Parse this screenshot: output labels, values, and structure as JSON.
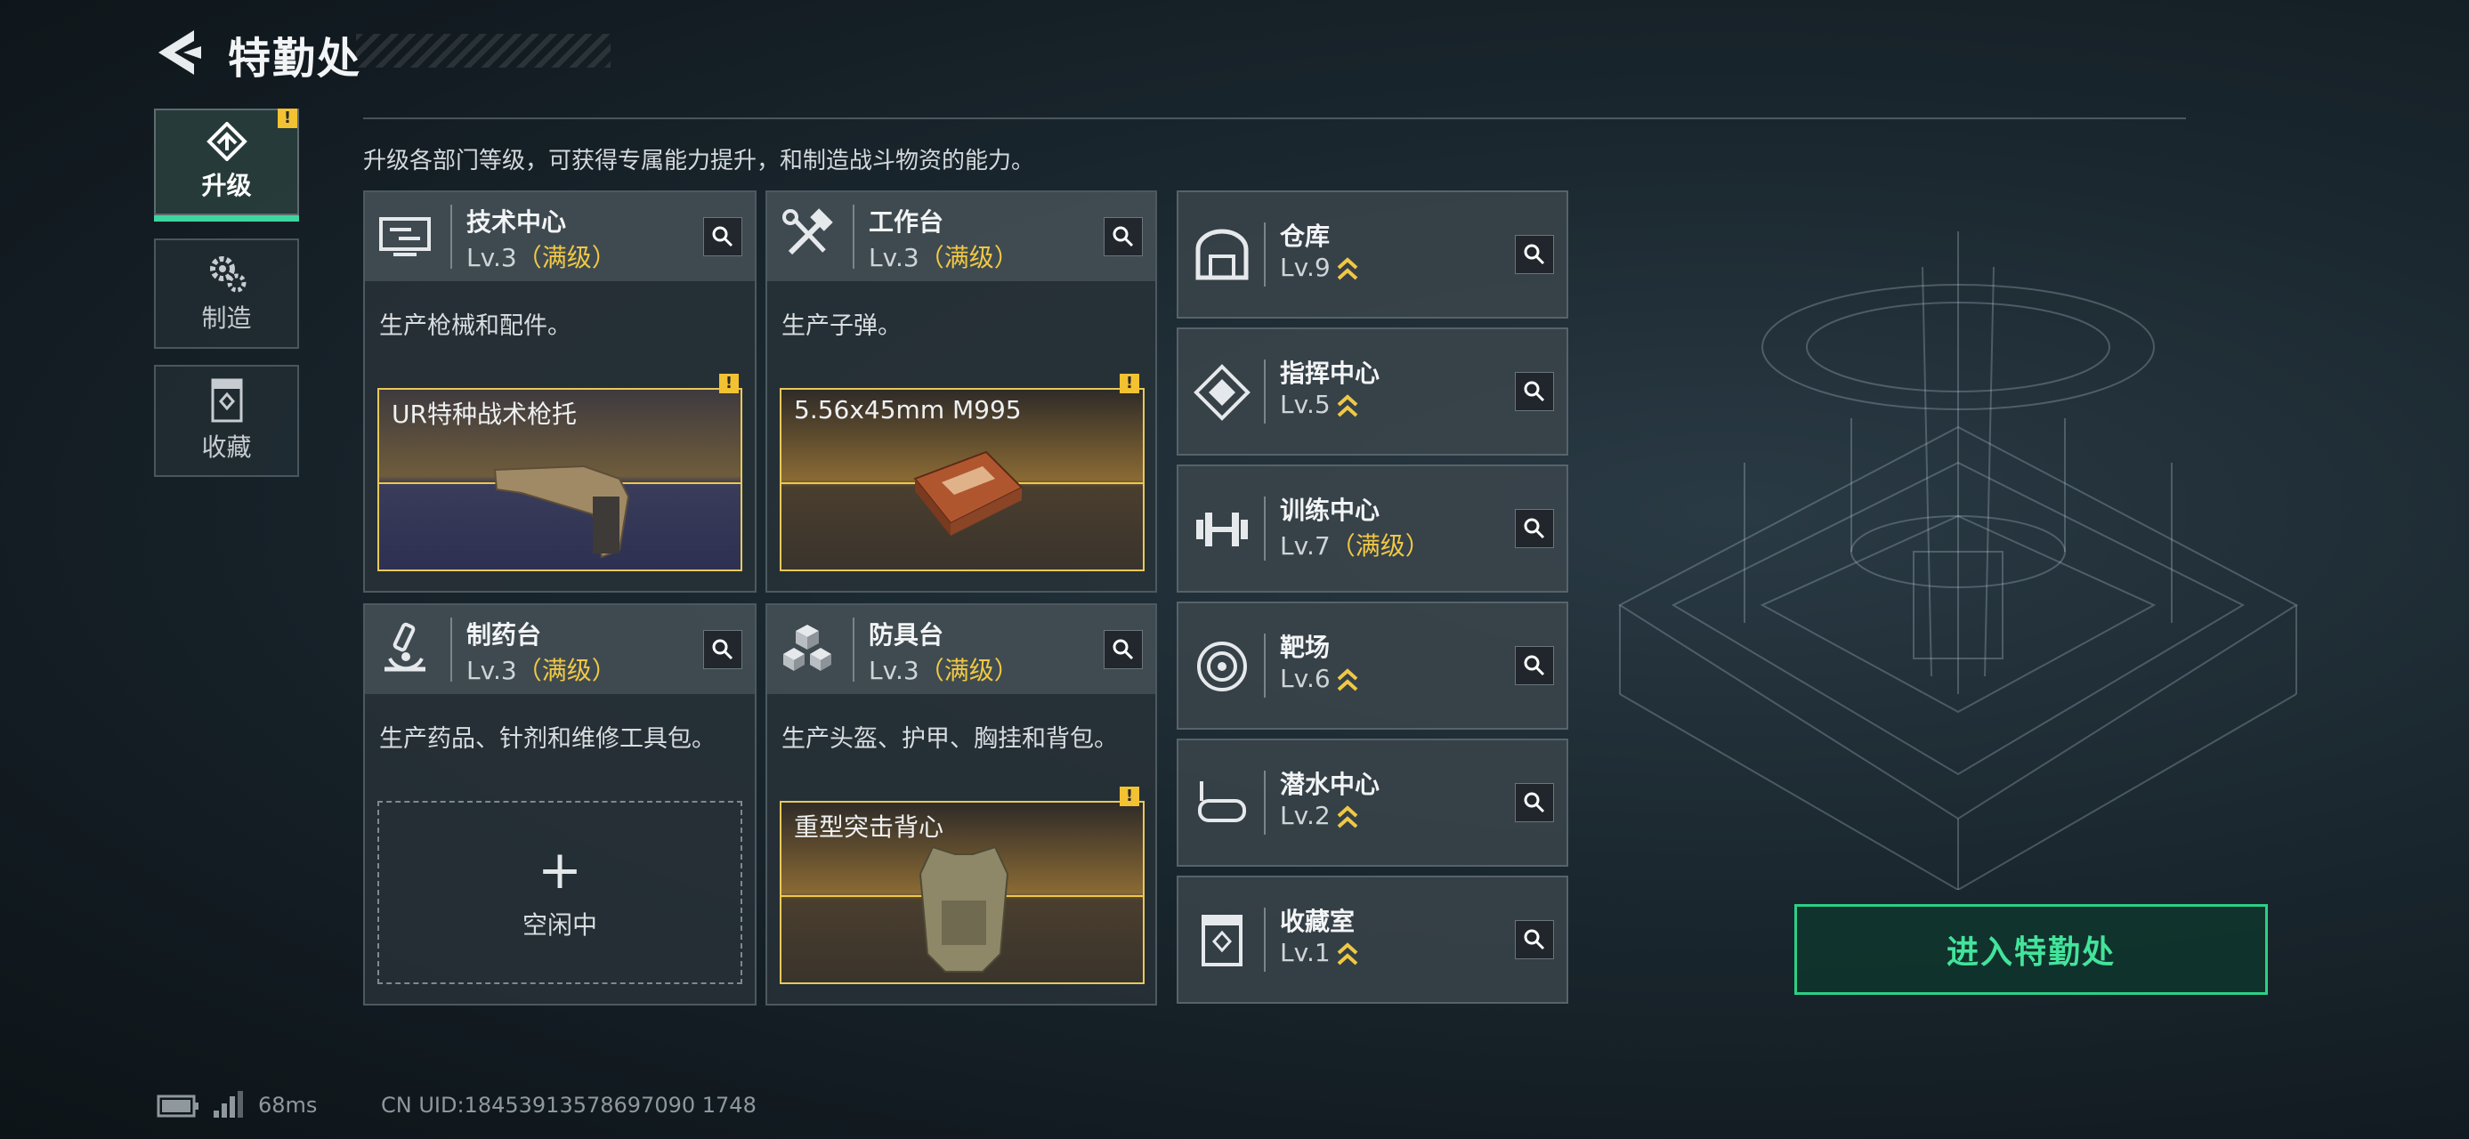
{
  "header": {
    "title": "特勤处"
  },
  "nav": [
    {
      "label": "升级",
      "icon": "upgrade-icon",
      "active": true
    },
    {
      "label": "制造",
      "icon": "gear-icon",
      "active": false
    },
    {
      "label": "收藏",
      "icon": "collection-icon",
      "active": false
    }
  ],
  "subtitle": "升级各部门等级，可获得专属能力提升，和制造战斗物资的能力。",
  "big_cards": [
    {
      "name": "技术中心",
      "level": "Lv.3",
      "max": "（满级）",
      "desc": "生产枪械和配件。",
      "slot": "UR特种战术枪托"
    },
    {
      "name": "工作台",
      "level": "Lv.3",
      "max": "（满级）",
      "desc": "生产子弹。",
      "slot": "5.56x45mm M995"
    },
    {
      "name": "制药台",
      "level": "Lv.3",
      "max": "（满级）",
      "desc": "生产药品、针剂和维修工具包。",
      "slot_empty": "空闲中"
    },
    {
      "name": "防具台",
      "level": "Lv.3",
      "max": "（满级）",
      "desc": "生产头盔、护甲、胸挂和背包。",
      "slot": "重型突击背心"
    }
  ],
  "small_cards": [
    {
      "name": "仓库",
      "level": "Lv.9"
    },
    {
      "name": "指挥中心",
      "level": "Lv.5"
    },
    {
      "name": "训练中心",
      "level": "Lv.7",
      "max": "（满级）"
    },
    {
      "name": "靶场",
      "level": "Lv.6"
    },
    {
      "name": "潜水中心",
      "level": "Lv.2"
    },
    {
      "name": "收藏室",
      "level": "Lv.1"
    }
  ],
  "enter_button": "进入特勤处",
  "footer": {
    "ping": "68ms",
    "uid": "CN UID:18453913578697090 1748"
  },
  "colors": {
    "accent": "#43e39b",
    "gold": "#f0c845",
    "warn": "#f2c232"
  }
}
